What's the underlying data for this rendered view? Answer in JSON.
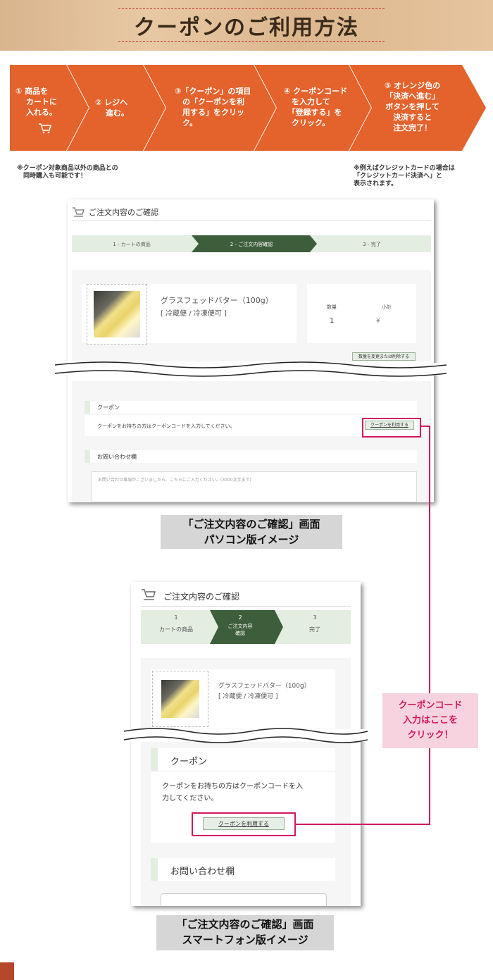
{
  "banner": {
    "title": "クーポンのご利用方法"
  },
  "steps": [
    {
      "text": "① 商品を\n　 カートに\n　 入れる。"
    },
    {
      "text": "② レジへ\n　 進む。"
    },
    {
      "text": "③「クーポン」の項目\n　の「クーポンを利\n　用する」をクリッ\n　ク。"
    },
    {
      "text": "④ クーポンコード\n　を入力して\n　「登録する」を\n　クリック。"
    },
    {
      "text": "⑤ オレンジ色の\n「決済へ進む」\nボタンを押して\n決済すると\n注文完了！"
    }
  ],
  "notes": {
    "left": "※クーポン対象商品以外の商品との\n　同時購入も可能です！",
    "right": "※例えばクレジットカードの場合は\n「クレジットカード決済へ」と\n表示されます。"
  },
  "pc": {
    "page_title": "ご注文内容のご確認",
    "progress": [
      "1 - カートの商品",
      "2 - ご注文内容確認",
      "3 - 完了"
    ],
    "product_name": "グラスフェッドバター（100g）",
    "product_shipping": "[ 冷蔵便 / 冷凍便可 ]",
    "qty_label": "数量",
    "qty_value": "1",
    "subtotal_label": "小計",
    "subtotal_value": "¥",
    "change_button": "数量を変更または削除する",
    "coupon_heading": "クーポン",
    "coupon_text": "クーポンをお持ちの方はクーポンコードを入力してください。",
    "coupon_button": "クーポンを利用する",
    "inquiry_heading": "お問い合わせ欄",
    "inquiry_placeholder": "お問い合わせ事項がございましたら、こちらにご入力ください。(3000文字まで)"
  },
  "pc_caption": "「ご注文内容のご確認」画面\nパソコン版イメージ",
  "sp": {
    "page_title": "ご注文内容のご確認",
    "steps": [
      {
        "num": "1",
        "label": "カートの商品"
      },
      {
        "num": "2",
        "label": "ご注文内容\n確認"
      },
      {
        "num": "3",
        "label": "完了"
      }
    ],
    "product_name": "グラスフェッドバター（100g）",
    "product_shipping": "[ 冷蔵便 / 冷凍便可 ]",
    "coupon_heading": "クーポン",
    "coupon_text": "クーポンをお持ちの方はクーポンコードを入\n力してください。",
    "coupon_button": "クーポンを利用する",
    "inquiry_heading": "お問い合わせ欄"
  },
  "sp_caption": "「ご注文内容のご確認」画面\nスマートフォン版イメージ",
  "callout": "クーポンコード\n入力はここを\nクリック！",
  "colors": {
    "orange": "#e4622c",
    "green_dark": "#3d5e3a",
    "green_light": "#e3eee1",
    "pink": "#d1195f",
    "pink_bg": "#f6d3de"
  }
}
